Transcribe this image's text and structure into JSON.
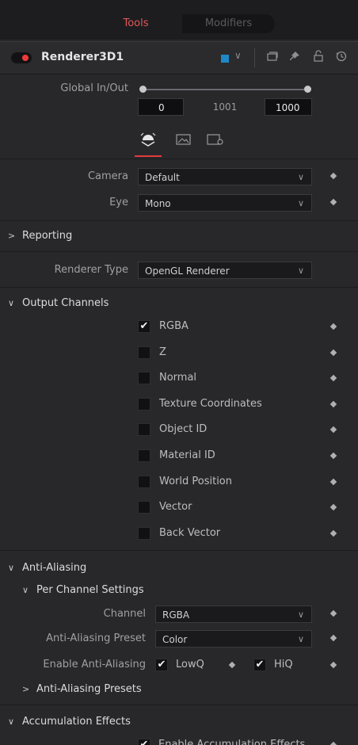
{
  "tabs": {
    "tools": "Tools",
    "modifiers": "Modifiers"
  },
  "header": {
    "node_name": "Renderer3D1",
    "color_chip": "#1e88c9",
    "chevron": "∨",
    "icons": [
      "window-icon",
      "pin-icon",
      "lock-icon",
      "reset-icon"
    ]
  },
  "global": {
    "label": "Global In/Out",
    "in_value": "0",
    "mid_value": "1001",
    "out_value": "1000"
  },
  "subtabs": [
    "controls-icon",
    "image-icon",
    "settings-icon"
  ],
  "camera": {
    "label": "Camera",
    "value": "Default"
  },
  "eye": {
    "label": "Eye",
    "value": "Mono"
  },
  "reporting": {
    "label": "Reporting"
  },
  "renderer_type": {
    "label": "Renderer Type",
    "value": "OpenGL Renderer"
  },
  "output_channels": {
    "label": "Output Channels",
    "items": [
      {
        "label": "RGBA",
        "checked": true
      },
      {
        "label": "Z",
        "checked": false
      },
      {
        "label": "Normal",
        "checked": false
      },
      {
        "label": "Texture Coordinates",
        "checked": false
      },
      {
        "label": "Object ID",
        "checked": false
      },
      {
        "label": "Material ID",
        "checked": false
      },
      {
        "label": "World Position",
        "checked": false
      },
      {
        "label": "Vector",
        "checked": false
      },
      {
        "label": "Back Vector",
        "checked": false
      }
    ]
  },
  "anti_aliasing": {
    "label": "Anti-Aliasing",
    "per_channel": "Per Channel Settings",
    "channel": {
      "label": "Channel",
      "value": "RGBA"
    },
    "preset": {
      "label": "Anti-Aliasing Preset",
      "value": "Color"
    },
    "enable": {
      "label": "Enable Anti-Aliasing",
      "lowq": "LowQ",
      "hiq": "HiQ"
    },
    "presets": "Anti-Aliasing Presets"
  },
  "accumulation": {
    "label": "Accumulation Effects",
    "enable": "Enable Accumulation Effects"
  },
  "check_glyph": "✔",
  "accent": "#e03b3b"
}
